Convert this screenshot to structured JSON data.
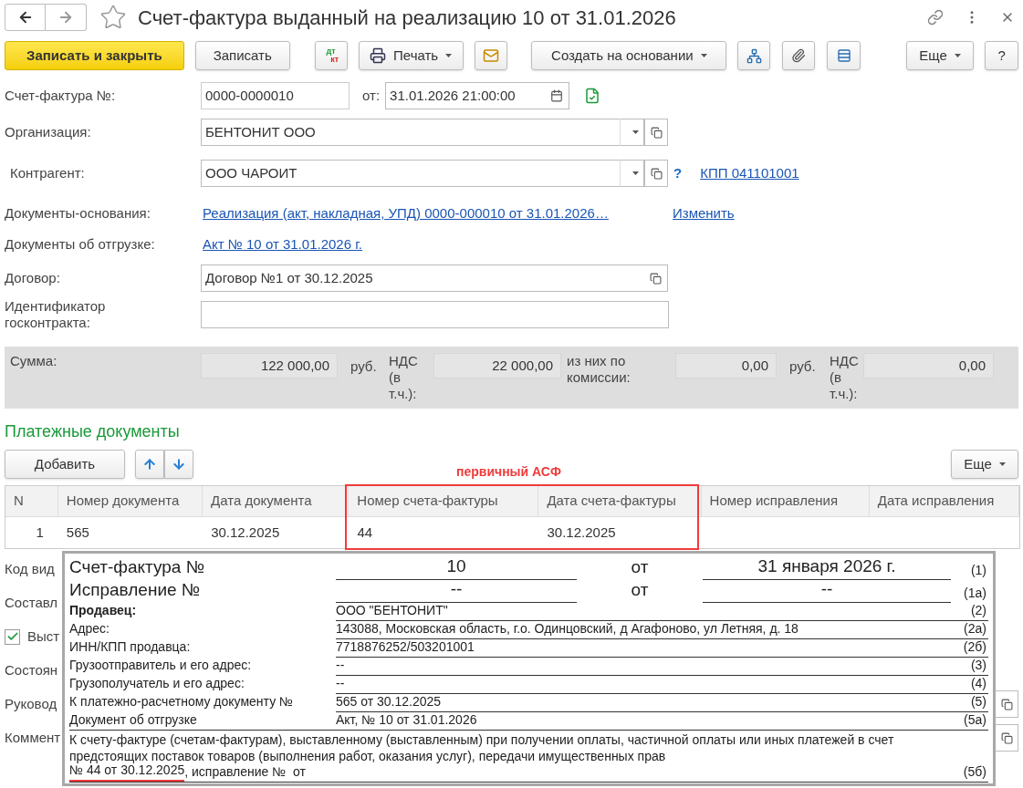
{
  "title": "Счет-фактура выданный на реализацию 10 от 31.01.2026",
  "favorite": false,
  "toolbar": {
    "save_close": "Записать и закрыть",
    "save": "Записать",
    "dt": "дт",
    "kt": "кт",
    "print": "Печать",
    "create_based": "Создать на основании",
    "more": "Еще",
    "help": "?"
  },
  "number": {
    "label": "Счет-фактура №:",
    "value": "0000-0000010",
    "date_label": "от:",
    "date": "31.01.2026 21:00:00"
  },
  "organization": {
    "label": "Организация:",
    "value": "БЕНТОНИТ ООО"
  },
  "counterparty": {
    "label": "Контрагент:",
    "value": "ООО ЧАРОИТ",
    "help": "?",
    "kpp_link": "КПП 041101001"
  },
  "base_docs": {
    "label": "Документы-основания:",
    "link": "Реализация (акт, накладная, УПД) 0000-000010 от 31.01.2026…",
    "change": "Изменить"
  },
  "shipment_docs": {
    "label": "Документы об отгрузке:",
    "link": "Акт № 10 от 31.01.2026 г."
  },
  "contract": {
    "label": "Договор:",
    "value": "Договор №1 от 30.12.2025"
  },
  "gov_id": {
    "label": "Идентификатор госконтракта:"
  },
  "sums": [
    {
      "label": "Сумма:",
      "value": "122 000,00",
      "unit": "руб."
    },
    {
      "label": "НДС (в т.ч.):",
      "value": "22 000,00"
    },
    {
      "label": "из них по комиссии:",
      "value": "0,00",
      "unit": "руб."
    },
    {
      "label": "НДС (в т.ч.):",
      "value": "0,00"
    }
  ],
  "payments": {
    "title": "Платежные документы",
    "add": "Добавить",
    "more": "Еще",
    "annotation": "первичный АСФ",
    "columns": [
      "N",
      "Номер документа",
      "Дата документа",
      "Номер счета-фактуры",
      "Дата счета-фактуры",
      "Номер исправления",
      "Дата исправления"
    ],
    "rows": [
      {
        "cells": [
          "1",
          "565",
          "30.12.2025",
          "44",
          "30.12.2025",
          "",
          ""
        ]
      }
    ]
  },
  "background_rows": [
    {
      "kind": "label",
      "text": "Код вид"
    },
    {
      "kind": "label",
      "text": "Составл"
    },
    {
      "kind": "checkbox",
      "text": "Выст",
      "checked": true
    },
    {
      "kind": "label",
      "text": "Состоян"
    },
    {
      "kind": "label",
      "text": "Руковод",
      "copy": true
    },
    {
      "kind": "label",
      "text": "Коммент",
      "copy": true
    }
  ],
  "preview": {
    "header": [
      {
        "label": "Счет-фактура №",
        "value": "10",
        "from": "от",
        "date": "31 января 2026 г.",
        "code": "(1)"
      },
      {
        "label": "Исправление №",
        "value": "--",
        "from": "от",
        "date": "--",
        "code": "(1а)"
      }
    ],
    "lines": [
      {
        "label": "Продавец:",
        "bold": true,
        "value": "ООО \"БЕНТОНИТ\"",
        "code": "(2)"
      },
      {
        "label": "Адрес:",
        "bold": false,
        "value": "143088, Московская область, г.о. Одинцовский, д Агафоново, ул Летняя, д. 18",
        "code": "(2а)"
      },
      {
        "label": "ИНН/КПП продавца:",
        "bold": false,
        "value": "7718876252/503201001",
        "code": "(2б)"
      },
      {
        "label": "Грузоотправитель и его адрес:",
        "bold": false,
        "value": "--",
        "code": "(3)"
      },
      {
        "label": "Грузополучатель и его адрес:",
        "bold": false,
        "value": "--",
        "code": "(4)"
      },
      {
        "label": "К платежно-расчетному документу №",
        "bold": false,
        "value": "565 от 30.12.2025",
        "code": "(5)"
      },
      {
        "label": "Документ об отгрузке",
        "bold": false,
        "value": "Акт, № 10 от 31.01.2026",
        "code": "(5а)"
      }
    ],
    "advance_text": "К счету-фактуре (счетам-фактурам), выставленному (выставленным) при получении оплаты, частичной оплаты или иных платежей в счет предстоящих поставок товаров (выполнения работ, оказания услуг), передачи имущественных прав",
    "advance_ref": "№ 44 от 30.12.2025",
    "advance_rest": ", исправление №  от",
    "advance_code": "(5б)"
  }
}
